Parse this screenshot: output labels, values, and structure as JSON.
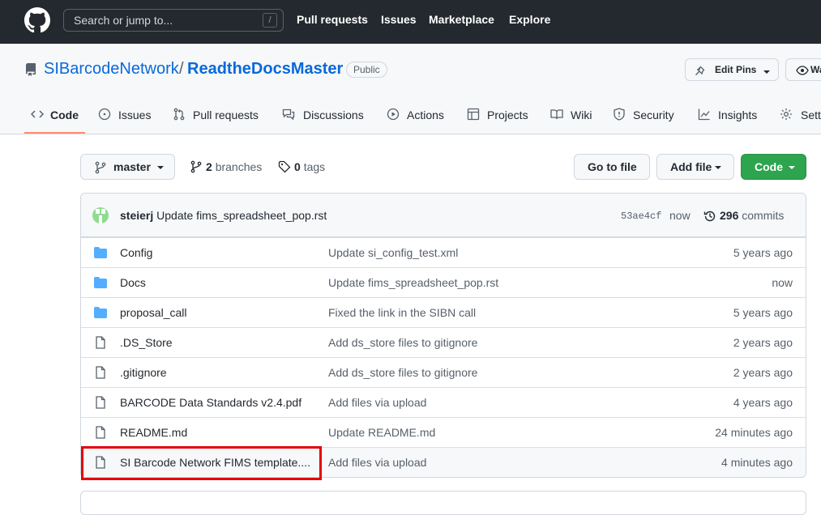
{
  "header": {
    "search_placeholder": "Search or jump to...",
    "slash_key": "/",
    "nav": [
      "Pull requests",
      "Issues",
      "Marketplace",
      "Explore"
    ]
  },
  "repo": {
    "owner": "SIBarcodeNetwork",
    "separator": "/",
    "name": "ReadtheDocsMaster",
    "visibility": "Public",
    "edit_pins_label": "Edit Pins",
    "watch_label": "Watch"
  },
  "tabs": [
    {
      "label": "Code",
      "icon": "code-icon",
      "active": true
    },
    {
      "label": "Issues",
      "icon": "issue-icon"
    },
    {
      "label": "Pull requests",
      "icon": "pull-request-icon"
    },
    {
      "label": "Discussions",
      "icon": "discussion-icon"
    },
    {
      "label": "Actions",
      "icon": "play-icon"
    },
    {
      "label": "Projects",
      "icon": "table-icon"
    },
    {
      "label": "Wiki",
      "icon": "book-icon"
    },
    {
      "label": "Security",
      "icon": "shield-icon"
    },
    {
      "label": "Insights",
      "icon": "graph-icon"
    },
    {
      "label": "Settings",
      "icon": "gear-icon"
    }
  ],
  "file_nav": {
    "branch": "master",
    "branches_count": "2",
    "branches_label": "branches",
    "tags_count": "0",
    "tags_label": "tags",
    "go_to_file": "Go to file",
    "add_file": "Add file",
    "code": "Code"
  },
  "latest_commit": {
    "author": "steierj",
    "message": "Update fims_spreadsheet_pop.rst",
    "sha": "53ae4cf",
    "time": "now",
    "commit_count": "296",
    "commits_label": "commits"
  },
  "files": [
    {
      "type": "folder",
      "name": "Config",
      "message": "Update si_config_test.xml",
      "age": "5 years ago"
    },
    {
      "type": "folder",
      "name": "Docs",
      "message": "Update fims_spreadsheet_pop.rst",
      "age": "now"
    },
    {
      "type": "folder",
      "name": "proposal_call",
      "message": "Fixed the link in the SIBN call",
      "age": "5 years ago"
    },
    {
      "type": "file",
      "name": ".DS_Store",
      "message": "Add ds_store files to gitignore",
      "age": "2 years ago"
    },
    {
      "type": "file",
      "name": ".gitignore",
      "message": "Add ds_store files to gitignore",
      "age": "2 years ago"
    },
    {
      "type": "file",
      "name": "BARCODE Data Standards v2.4.pdf",
      "message": "Add files via upload",
      "age": "4 years ago"
    },
    {
      "type": "file",
      "name": "README.md",
      "message": "Update README.md",
      "age": "24 minutes ago"
    },
    {
      "type": "file",
      "name": "SI Barcode Network FIMS template....",
      "message": "Add files via upload",
      "age": "4 minutes ago"
    }
  ],
  "colors": {
    "header_bg": "#24292f",
    "link": "#0969da",
    "primary_button": "#2da44e",
    "folder_icon": "#54aeff",
    "active_tab_underline": "#fd8c73",
    "annotation_box": "#e5000b"
  }
}
